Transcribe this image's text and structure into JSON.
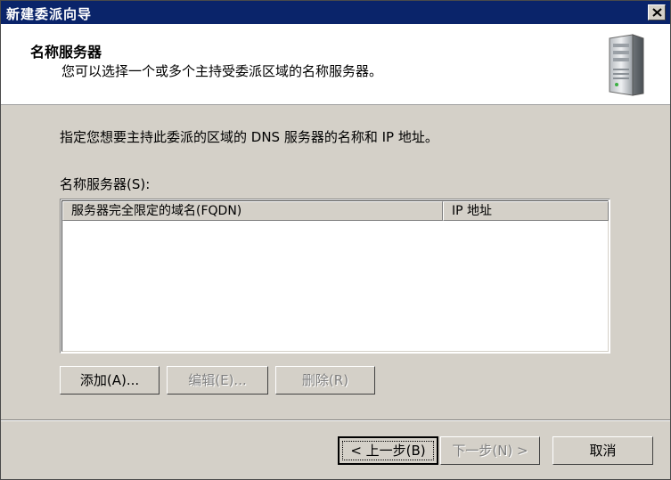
{
  "window": {
    "title": "新建委派向导"
  },
  "header": {
    "title": "名称服务器",
    "subtitle": "您可以选择一个或多个主持受委派区域的名称服务器。"
  },
  "body": {
    "instruction": "指定您想要主持此委派的区域的 DNS 服务器的名称和 IP 地址。",
    "list_label": "名称服务器(S):",
    "columns": [
      "服务器完全限定的域名(FQDN)",
      "IP 地址"
    ],
    "rows": []
  },
  "buttons": {
    "add": "添加(A)...",
    "edit": "编辑(E)...",
    "delete": "删除(R)",
    "back": "< 上一步(B)",
    "next": "下一步(N) >",
    "cancel": "取消"
  },
  "icons": {
    "close": "close-icon",
    "server": "server-icon"
  }
}
